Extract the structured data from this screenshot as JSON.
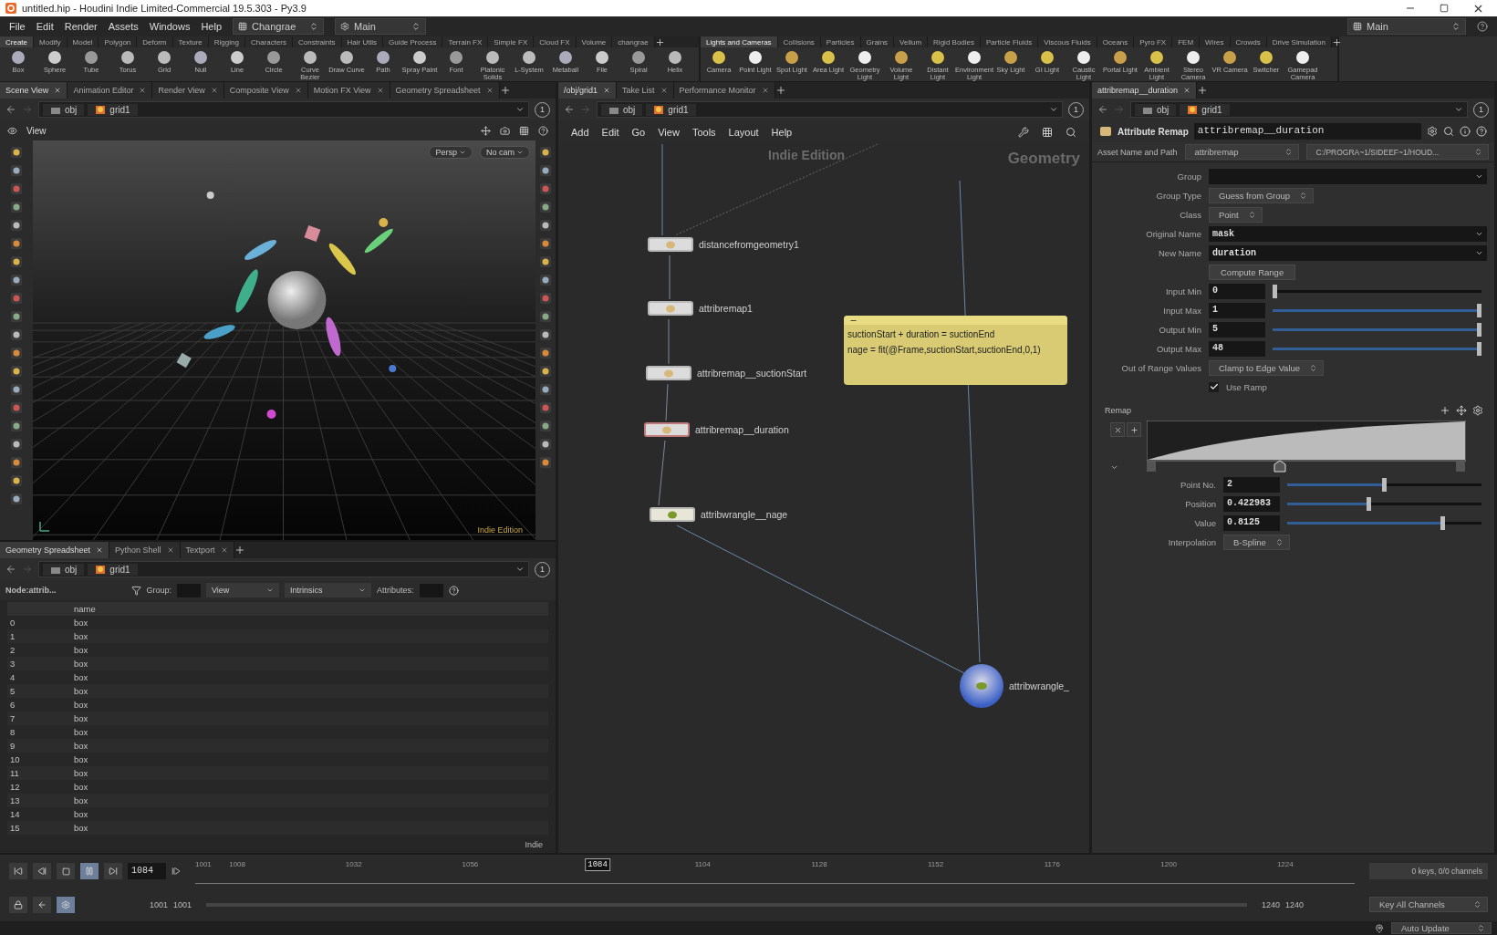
{
  "window": {
    "title": "untitled.hip - Houdini Indie Limited-Commercial 19.5.303 - Py3.9"
  },
  "menu": [
    "File",
    "Edit",
    "Render",
    "Assets",
    "Windows",
    "Help"
  ],
  "desktop": "Changrae",
  "context_top": "Main",
  "context_right": "Main",
  "shelves": [
    {
      "tabs": [
        {
          "label": "Create",
          "selected": true
        },
        {
          "label": "Modify",
          "selected": false
        },
        {
          "label": "Model",
          "selected": false
        },
        {
          "label": "Polygon",
          "selected": false
        },
        {
          "label": "Deform",
          "selected": false
        },
        {
          "label": "Texture",
          "selected": false
        },
        {
          "label": "Rigging",
          "selected": false
        },
        {
          "label": "Characters",
          "selected": false
        },
        {
          "label": "Constraints",
          "selected": false
        },
        {
          "label": "Hair Utils",
          "selected": false
        },
        {
          "label": "Guide Process",
          "selected": false
        },
        {
          "label": "Terrain FX",
          "selected": false
        },
        {
          "label": "Simple FX",
          "selected": false
        },
        {
          "label": "Cloud FX",
          "selected": false
        },
        {
          "label": "Volume",
          "selected": false
        },
        {
          "label": "changrae",
          "selected": false
        }
      ],
      "tools": [
        "Box",
        "Sphere",
        "Tube",
        "Torus",
        "Grid",
        "Null",
        "Line",
        "Circle",
        "Curve Bezier",
        "Draw Curve",
        "Path",
        "Spray Paint",
        "Font",
        "Platonic Solids",
        "L-System",
        "Metaball",
        "File",
        "Spiral",
        "Helix"
      ]
    },
    {
      "tabs": [
        {
          "label": "Lights and Cameras",
          "selected": true
        },
        {
          "label": "Collisions",
          "selected": false
        },
        {
          "label": "Particles",
          "selected": false
        },
        {
          "label": "Grains",
          "selected": false
        },
        {
          "label": "Vellum",
          "selected": false
        },
        {
          "label": "Rigid Bodies",
          "selected": false
        },
        {
          "label": "Particle Fluids",
          "selected": false
        },
        {
          "label": "Viscous Fluids",
          "selected": false
        },
        {
          "label": "Oceans",
          "selected": false
        },
        {
          "label": "Pyro FX",
          "selected": false
        },
        {
          "label": "FEM",
          "selected": false
        },
        {
          "label": "Wires",
          "selected": false
        },
        {
          "label": "Crowds",
          "selected": false
        },
        {
          "label": "Drive Simulation",
          "selected": false
        }
      ],
      "tools": [
        "Camera",
        "Point Light",
        "Spot Light",
        "Area Light",
        "Geometry Light",
        "Volume Light",
        "Distant Light",
        "Environment Light",
        "Sky Light",
        "GI Light",
        "Caustic Light",
        "Portal Light",
        "Ambient Light",
        "Stereo Camera",
        "VR Camera",
        "Switcher",
        "Gamepad Camera"
      ]
    }
  ],
  "scene": {
    "tabs": [
      {
        "label": "Scene View",
        "selected": true
      },
      {
        "label": "Animation Editor",
        "selected": false
      },
      {
        "label": "Render View",
        "selected": false
      },
      {
        "label": "Composite View",
        "selected": false
      },
      {
        "label": "Motion FX View",
        "selected": false
      },
      {
        "label": "Geometry Spreadsheet",
        "selected": false
      }
    ],
    "path": [
      "obj",
      "grid1"
    ],
    "pin": "1",
    "title": "View",
    "camera_menus": [
      "Persp",
      "No cam"
    ],
    "edition": "Indie Edition"
  },
  "spreadsheet": {
    "tabs": [
      {
        "label": "Geometry Spreadsheet",
        "selected": true
      },
      {
        "label": "Python Shell",
        "selected": false
      },
      {
        "label": "Textport",
        "selected": false
      }
    ],
    "path": [
      "obj",
      "grid1"
    ],
    "pin": "1",
    "node": "Node:attrib...",
    "group_label": "Group:",
    "view_menu": "View",
    "intrinsics_menu": "Intrinsics",
    "attributes_label": "Attributes:",
    "columns": [
      "name"
    ],
    "rows": [
      {
        "index": "0",
        "name": "box"
      },
      {
        "index": "1",
        "name": "box"
      },
      {
        "index": "2",
        "name": "box"
      },
      {
        "index": "3",
        "name": "box"
      },
      {
        "index": "4",
        "name": "box"
      },
      {
        "index": "5",
        "name": "box"
      },
      {
        "index": "6",
        "name": "box"
      },
      {
        "index": "7",
        "name": "box"
      },
      {
        "index": "8",
        "name": "box"
      },
      {
        "index": "9",
        "name": "box"
      },
      {
        "index": "10",
        "name": "box"
      },
      {
        "index": "11",
        "name": "box"
      },
      {
        "index": "12",
        "name": "box"
      },
      {
        "index": "13",
        "name": "box"
      },
      {
        "index": "14",
        "name": "box"
      },
      {
        "index": "15",
        "name": "box"
      }
    ],
    "corner": "Indie"
  },
  "network": {
    "tabs": [
      {
        "label": "/obj/grid1",
        "selected": true
      },
      {
        "label": "Take List",
        "selected": false
      },
      {
        "label": "Performance Monitor",
        "selected": false
      }
    ],
    "path": [
      "obj",
      "grid1"
    ],
    "pin": "1",
    "menu": [
      "Add",
      "Edit",
      "Go",
      "View",
      "Tools",
      "Layout",
      "Help"
    ],
    "edition": "Indie Edition",
    "context": "Geometry",
    "nodes": [
      {
        "name": "distancefromgeometry1",
        "kind": "box",
        "selected": false
      },
      {
        "name": "attribremap1",
        "kind": "box",
        "selected": false
      },
      {
        "name": "attribremap__suctionStart",
        "kind": "box",
        "selected": false
      },
      {
        "name": "attribremap__duration",
        "kind": "box",
        "selected": true
      },
      {
        "name": "attribwrangle__nage",
        "kind": "wrangle",
        "selected": false
      },
      {
        "name": "attribwrangle_",
        "kind": "ball",
        "selected": false
      }
    ],
    "note": [
      "suctionStart + duration = suctionEnd",
      "nage = fit(@Frame,suctionStart,suctionEnd,0,1)"
    ]
  },
  "parameters": {
    "tab": "attribremap__duration",
    "path": [
      "obj",
      "grid1"
    ],
    "pin": "1",
    "type": "Attribute Remap",
    "name": "attribremap__duration",
    "asset_label": "Asset Name and Path",
    "asset": "attribremap",
    "asset_path": "C:/PROGRA~1/SIDEEF~1/HOUD...",
    "fields": [
      {
        "kind": "text",
        "label": "Group"
      },
      {
        "kind": "menu",
        "label": "Group Type",
        "value": "Guess from Group"
      },
      {
        "kind": "menu",
        "label": "Class",
        "value": "Point"
      },
      {
        "kind": "text",
        "label": "Original Name",
        "value": "mask"
      },
      {
        "kind": "text",
        "label": "New Name",
        "value": "duration"
      },
      {
        "kind": "button",
        "text": "Compute Range"
      },
      {
        "kind": "slider",
        "label": "Input Min",
        "value": "0",
        "level": 0
      },
      {
        "kind": "slider",
        "label": "Input Max",
        "value": "1",
        "level": 1
      },
      {
        "kind": "slider",
        "label": "Output Min",
        "value": "5",
        "level": 1
      },
      {
        "kind": "slider",
        "label": "Output Max",
        "value": "48",
        "level": 1
      },
      {
        "kind": "menu",
        "label": "Out of Range Values",
        "value": "Clamp to Edge Value"
      },
      {
        "kind": "check",
        "text": "Use Ramp",
        "checked": true
      }
    ],
    "ramp": {
      "label": "Remap",
      "fields": [
        {
          "kind": "slider",
          "label": "Point No.",
          "value": "2",
          "level": 0.5
        },
        {
          "kind": "slider",
          "label": "Position",
          "value": "0.422983",
          "level": 0.42
        },
        {
          "kind": "slider",
          "label": "Value",
          "value": "0.8125",
          "level": 0.81
        },
        {
          "kind": "menu",
          "label": "Interpolation",
          "value": "B-Spline"
        }
      ]
    }
  },
  "timeline": {
    "frame": "1084",
    "ticks": [
      "1001",
      "1008",
      "1032",
      "1056",
      "1104",
      "1128",
      "1152",
      "1176",
      "1200",
      "1224"
    ],
    "playhead": {
      "label": "1084",
      "level": 0.347
    },
    "start": "1001",
    "range_start": "1001",
    "range_end": "1240",
    "end": "1240",
    "keys": "0 keys, 0/0 channels",
    "key_all": "Key All Channels"
  },
  "status": {
    "update": "Auto Update"
  }
}
